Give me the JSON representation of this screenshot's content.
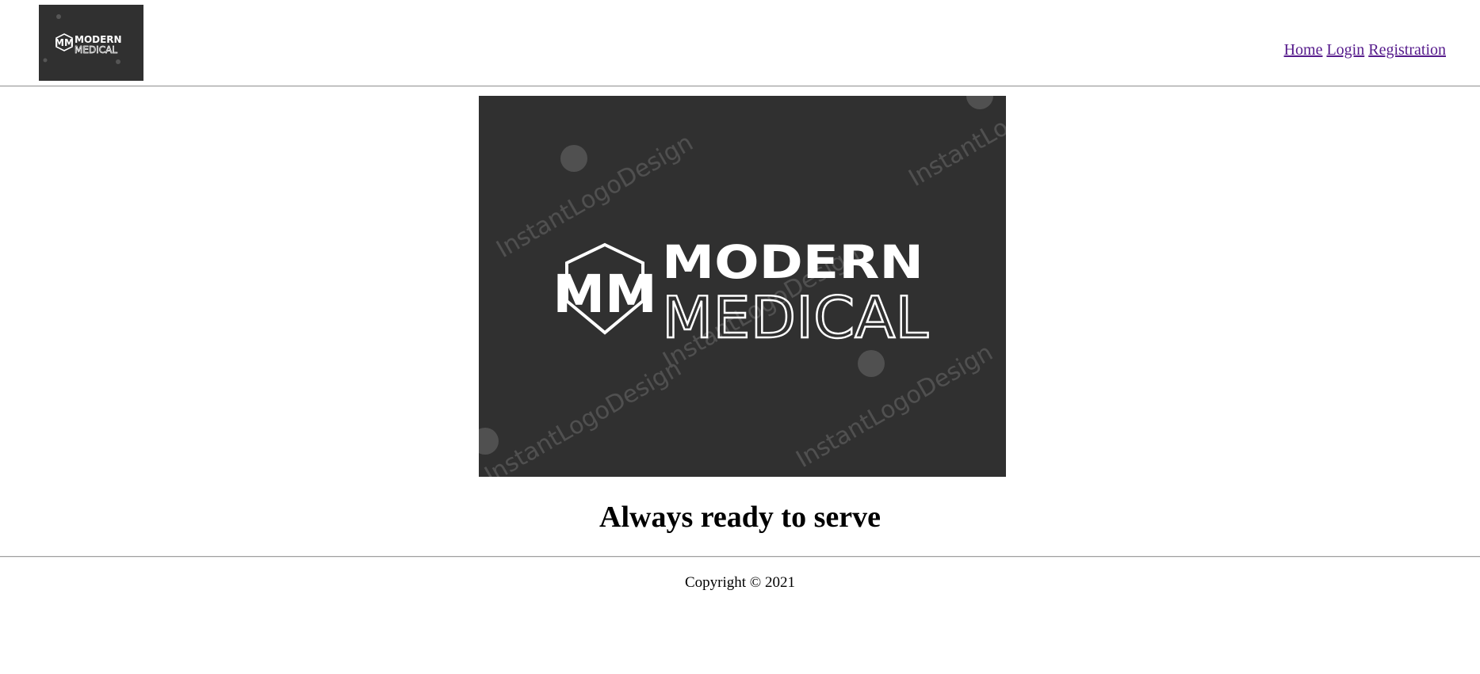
{
  "brand": {
    "logo_line1": "MODERN",
    "logo_line2": "MEDICAL",
    "monogram": "MM",
    "watermark": "InstantLogoDesign",
    "background_color": "#303030",
    "foreground_color": "#ffffff"
  },
  "nav": {
    "links": [
      {
        "label": "Home"
      },
      {
        "label": "Login"
      },
      {
        "label": "Registration"
      }
    ],
    "link_color": "#551a8b"
  },
  "main": {
    "tagline": "Always ready to serve"
  },
  "footer": {
    "copyright": "Copyright © 2021"
  }
}
